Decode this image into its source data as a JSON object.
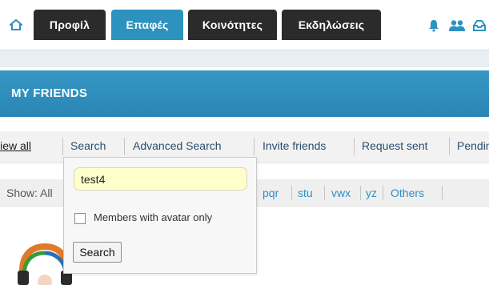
{
  "topnav": {
    "tabs": [
      {
        "label": "Προφίλ",
        "state": "default"
      },
      {
        "label": "Επαφές",
        "state": "active"
      },
      {
        "label": "Κοινότητες",
        "state": "default"
      },
      {
        "label": "Εκδηλώσεις",
        "state": "default"
      }
    ],
    "icons": [
      "home-icon",
      "bell-icon",
      "friends-icon",
      "inbox-icon"
    ],
    "colors": {
      "active_tab": "#2e92bf",
      "default_tab": "#2b2b2b",
      "icon": "#2e92bf"
    }
  },
  "header": {
    "title": "MY FRIENDS",
    "color": "#2e92bf"
  },
  "subtabs": [
    {
      "label": "View all"
    },
    {
      "label": "Search"
    },
    {
      "label": "Advanced Search"
    },
    {
      "label": "Invite friends"
    },
    {
      "label": "Request sent"
    },
    {
      "label": "Pending"
    }
  ],
  "show_filter": {
    "label": "Show: All",
    "letters": [
      "pqr",
      "stu",
      "vwx",
      "yz",
      "Others"
    ]
  },
  "search_panel": {
    "query": "test4",
    "checkbox_label": "Members with avatar only",
    "checkbox_checked": false,
    "button_label": "Search",
    "input_background": "#ffffcc"
  }
}
